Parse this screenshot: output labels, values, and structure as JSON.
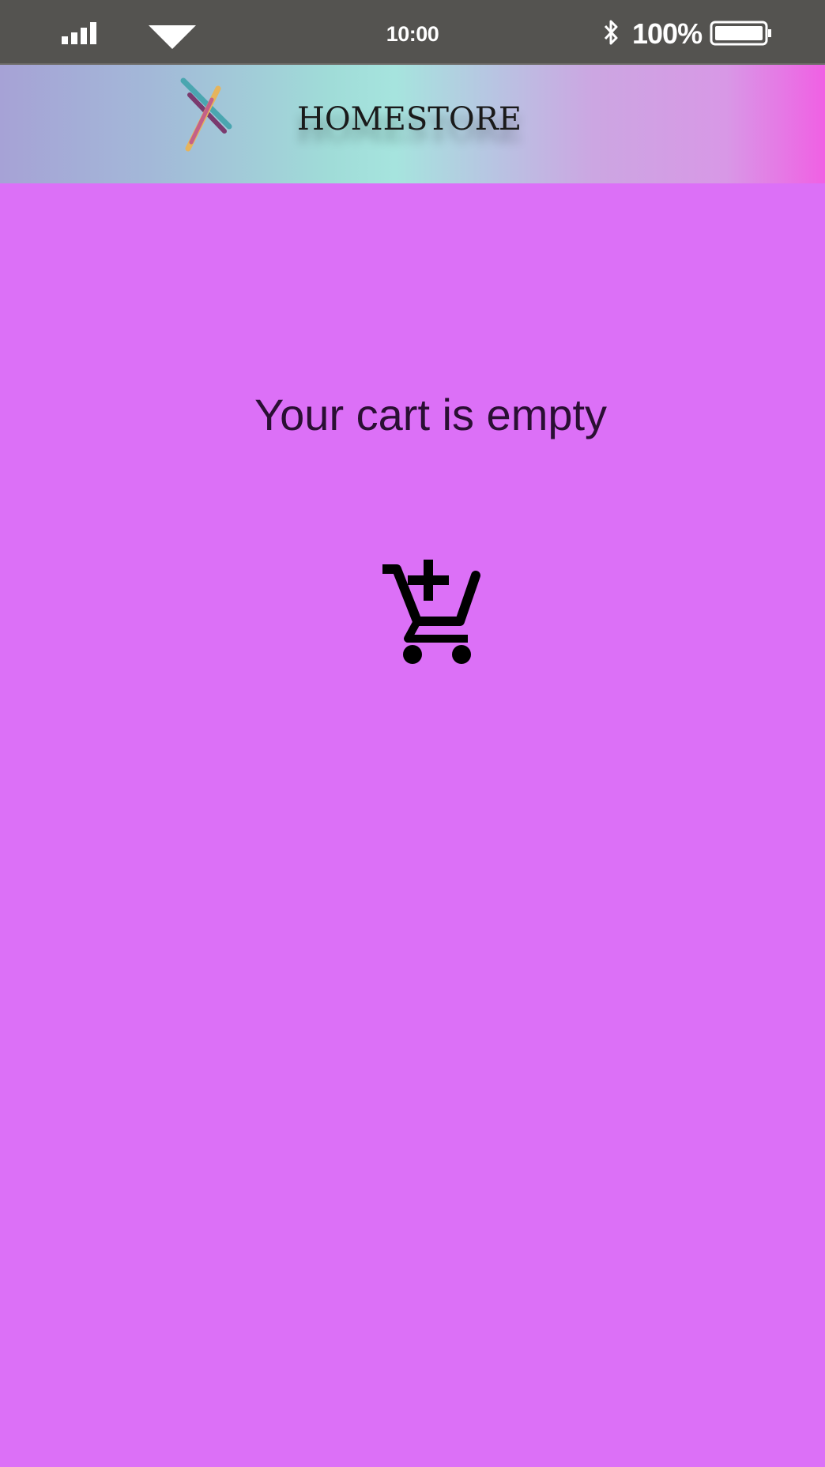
{
  "status_bar": {
    "time": "10:00",
    "battery_percent": "100%",
    "icons": [
      "signal-icon",
      "wifi-icon",
      "bluetooth-icon",
      "battery-icon"
    ]
  },
  "header": {
    "brand": "HOMESTORE",
    "logo_icon": "homestore-logo"
  },
  "main": {
    "empty_message": "Your cart is empty",
    "action_icon": "add-shopping-cart-icon"
  },
  "colors": {
    "background": "#dc70f7",
    "status_bar": "#545350",
    "header_gradient_start": "#a6a2d6",
    "header_gradient_mid": "#a0dcd8",
    "header_gradient_end": "#f060e4",
    "text": "#2a0f33"
  }
}
